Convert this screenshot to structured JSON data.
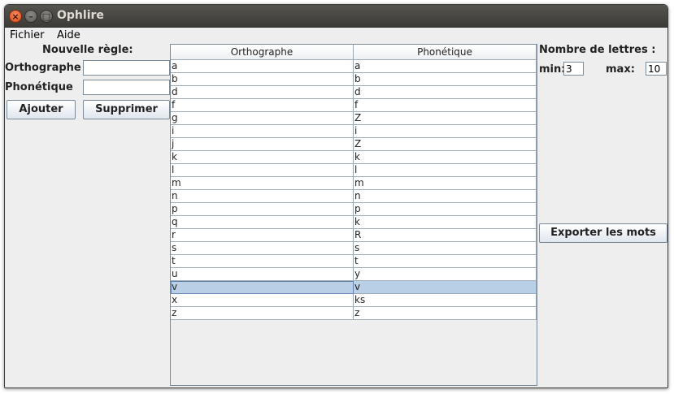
{
  "window": {
    "title": "Ophlire"
  },
  "menu": [
    "Fichier",
    "Aide"
  ],
  "left_panel": {
    "header": "Nouvelle règle:",
    "orthographe_label": "Orthographe",
    "orthographe_value": "",
    "phonetique_label": "Phonétique",
    "phonetique_value": "",
    "add_button": "Ajouter",
    "delete_button": "Supprimer"
  },
  "table": {
    "columns": [
      "Orthographe",
      "Phonétique"
    ],
    "rows": [
      [
        "a",
        "a"
      ],
      [
        "b",
        "b"
      ],
      [
        "d",
        "d"
      ],
      [
        "f",
        "f"
      ],
      [
        "g",
        "Z"
      ],
      [
        "i",
        "i"
      ],
      [
        "j",
        "Z"
      ],
      [
        "k",
        "k"
      ],
      [
        "l",
        "l"
      ],
      [
        "m",
        "m"
      ],
      [
        "n",
        "n"
      ],
      [
        "p",
        "p"
      ],
      [
        "q",
        "k"
      ],
      [
        "r",
        "R"
      ],
      [
        "s",
        "s"
      ],
      [
        "t",
        "t"
      ],
      [
        "u",
        "y"
      ],
      [
        "v",
        "v"
      ],
      [
        "x",
        "ks"
      ],
      [
        "z",
        "z"
      ]
    ],
    "selected_row": 17
  },
  "right_panel": {
    "header": "Nombre de lettres :",
    "min_label": "min:",
    "min_value": "3",
    "max_label": "max:",
    "max_value": "10",
    "export_button": "Exporter les mots"
  }
}
